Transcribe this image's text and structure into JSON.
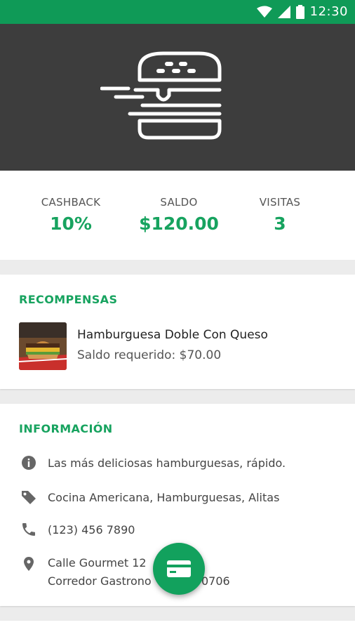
{
  "status_bar": {
    "time": "12:30"
  },
  "stats": {
    "cashback_label": "CASHBACK",
    "cashback_value": "10%",
    "saldo_label": "SALDO",
    "saldo_value": "$120.00",
    "visitas_label": "VISITAS",
    "visitas_value": "3"
  },
  "rewards": {
    "title": "RECOMPENSAS",
    "items": [
      {
        "name": "Hamburguesa Doble Con Queso",
        "requirement": "Saldo requerido: $70.00"
      }
    ]
  },
  "info": {
    "title": "INFORMACIÓN",
    "description": "Las más deliciosas hamburguesas, rápido.",
    "categories": "Cocina Americana, Hamburguesas, Alitas",
    "phone": "(123) 456 7890",
    "address_line1": "Calle Gourmet 12",
    "address_line2": "Corredor Gastrono",
    "address_line2_tail": "0706"
  },
  "colors": {
    "accent": "#17a35f",
    "status_bar": "#0f9a57",
    "hero_bg": "#3d3d3d",
    "fab": "#12a15d"
  },
  "icons": [
    "wifi-icon",
    "signal-icon",
    "battery-icon",
    "burger-logo-icon",
    "info-icon",
    "tag-icon",
    "phone-icon",
    "location-icon",
    "card-icon"
  ]
}
